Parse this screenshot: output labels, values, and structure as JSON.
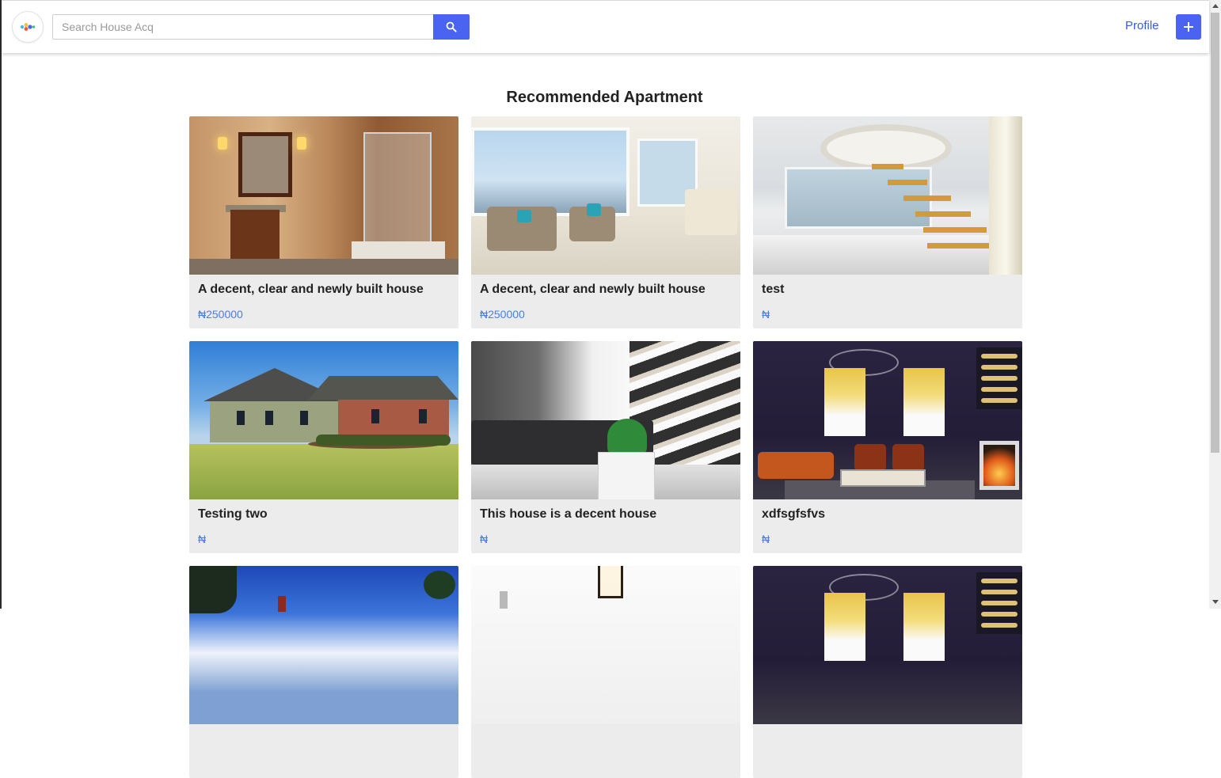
{
  "header": {
    "logo_icon": "colorful-dots-logo",
    "search": {
      "placeholder": "Search House Acq",
      "value": ""
    },
    "search_button_icon": "search-icon",
    "profile_label": "Profile",
    "add_button_icon": "plus-icon",
    "accent_color": "#4a63f0"
  },
  "main": {
    "section_title": "Recommended Apartment",
    "cards": [
      {
        "title": "A decent, clear and newly built house",
        "price": "₦250000",
        "image": "bathroom-photo"
      },
      {
        "title": "A decent, clear and newly built house",
        "price": "₦250000",
        "image": "living-room-photo"
      },
      {
        "title": "test",
        "price": "₦",
        "image": "spiral-staircase-photo"
      },
      {
        "title": "Testing two",
        "price": "₦",
        "image": "house-exterior-photo"
      },
      {
        "title": "This house is a decent house",
        "price": "₦",
        "image": "modern-staircase-photo"
      },
      {
        "title": "xdfsgfsfvs",
        "price": "₦",
        "image": "dark-lounge-photo"
      },
      {
        "title": "",
        "price": "",
        "image": "palm-trees-photo"
      },
      {
        "title": "",
        "price": "",
        "image": "white-room-photo"
      },
      {
        "title": "",
        "price": "",
        "image": "dark-lounge-photo"
      }
    ],
    "price_color": "#4a7de8"
  }
}
